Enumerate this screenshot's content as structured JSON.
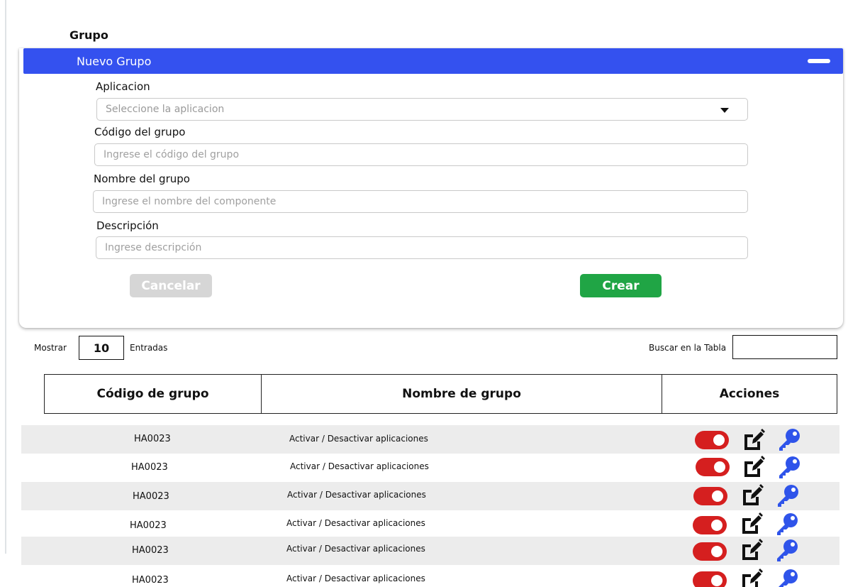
{
  "page": {
    "title": "Grupo"
  },
  "form": {
    "header": "Nuevo Grupo",
    "aplicacion": {
      "label": "Aplicacion",
      "placeholder": "Seleccione la aplicacion"
    },
    "codigo": {
      "label": "Código del grupo",
      "placeholder": "Ingrese el código del grupo"
    },
    "nombre": {
      "label": "Nombre del grupo",
      "placeholder": "Ingrese el nombre del componente"
    },
    "descripcion": {
      "label": "Descripción",
      "placeholder": "Ingrese descripción"
    },
    "cancel_label": "Cancelar",
    "create_label": "Crear"
  },
  "table_controls": {
    "show_label": "Mostrar",
    "page_length": "10",
    "entries_label": "Entradas",
    "search_label": "Buscar en la Tabla"
  },
  "table": {
    "headers": [
      "Código de grupo",
      "Nombre de grupo",
      "Acciones"
    ],
    "rows": [
      {
        "code": "HA0023",
        "name": "Activar / Desactivar aplicaciones"
      },
      {
        "code": "HA0023",
        "name": "Activar / Desactivar aplicaciones"
      },
      {
        "code": "HA0023",
        "name": "Activar / Desactivar aplicaciones"
      },
      {
        "code": "HA0023",
        "name": "Activar / Desactivar aplicaciones"
      },
      {
        "code": "HA0023",
        "name": "Activar / Desactivar aplicaciones"
      },
      {
        "code": "HA0023",
        "name": "Activar / Desactivar aplicaciones"
      }
    ]
  },
  "icons": {
    "collapse": "minus-icon",
    "dropdown": "caret-down-icon",
    "toggle": "toggle-on-icon",
    "edit": "edit-icon",
    "key": "key-icon"
  },
  "colors": {
    "header_blue": "#3451ef",
    "create_green": "#20a545",
    "cancel_grey": "#d6d6d6",
    "toggle_red": "#d51f1f",
    "key_blue": "#2f54ea"
  }
}
